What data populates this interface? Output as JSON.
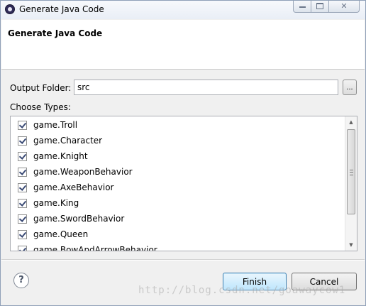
{
  "window": {
    "title": "Generate Java Code",
    "controls": {
      "minimize": "—",
      "maximize": "□",
      "close": "✕"
    }
  },
  "header": {
    "title": "Generate Java Code"
  },
  "output_folder": {
    "label": "Output Folder:",
    "value": "src",
    "browse_label": "..."
  },
  "types": {
    "label": "Choose Types:",
    "items": [
      {
        "label": "game.Troll",
        "checked": true
      },
      {
        "label": "game.Character",
        "checked": true
      },
      {
        "label": "game.Knight",
        "checked": true
      },
      {
        "label": "game.WeaponBehavior",
        "checked": true
      },
      {
        "label": "game.AxeBehavior",
        "checked": true
      },
      {
        "label": "game.King",
        "checked": true
      },
      {
        "label": "game.SwordBehavior",
        "checked": true
      },
      {
        "label": "game.Queen",
        "checked": true
      },
      {
        "label": "game.BowAndArrowBehavior",
        "checked": true
      }
    ]
  },
  "footer": {
    "help_icon": "?",
    "finish_label": "Finish",
    "cancel_label": "Cancel"
  },
  "watermark": "http://blog.csdn.net/goawaycow1"
}
